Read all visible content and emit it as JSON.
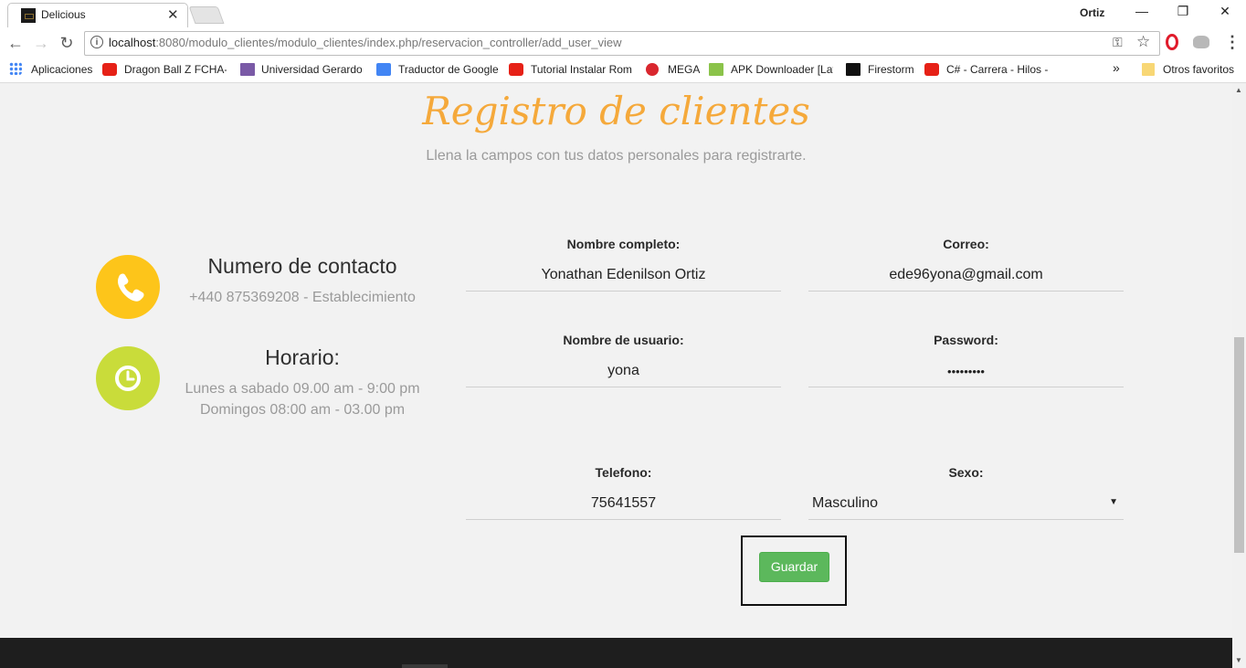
{
  "browser": {
    "tab_title": "Delicious",
    "profile": "Ortiz",
    "url_host": "localhost",
    "url_rest": ":8080/modulo_clientes/modulo_clientes/index.php/reservacion_controller/add_user_view",
    "bookmarks": [
      {
        "label": "Aplicaciones",
        "icon": "apps-grid-icon",
        "color": "#4285f4"
      },
      {
        "label": "Dragon Ball Z FCHA-L",
        "icon": "youtube-icon",
        "color": "#e62117"
      },
      {
        "label": "Universidad Gerardo",
        "icon": "university-icon",
        "color": "#7a5aa6"
      },
      {
        "label": "Traductor de Google",
        "icon": "google-translate-icon",
        "color": "#4285f4"
      },
      {
        "label": "Tutorial Instalar Rom",
        "icon": "youtube-icon",
        "color": "#e62117"
      },
      {
        "label": "MEGA",
        "icon": "mega-icon",
        "color": "#d9272e"
      },
      {
        "label": "APK Downloader [Lat",
        "icon": "apk-downloader-icon",
        "color": "#8bc34a"
      },
      {
        "label": "Firestorm",
        "icon": "firestorm-icon",
        "color": "#111111"
      },
      {
        "label": "C# - Carrera - Hilos -",
        "icon": "youtube-icon",
        "color": "#e62117"
      }
    ],
    "overflow_label": "»",
    "other_bookmarks": "Otros favoritos"
  },
  "page": {
    "title": "Registro de clientes",
    "subtitle": "Llena la campos con tus datos personales para registrarte.",
    "contact": {
      "heading": "Numero de contacto",
      "text": "+440 875369208 - Establecimiento",
      "icon": "phone-icon",
      "color": "#fdc51a"
    },
    "hours": {
      "heading": "Horario:",
      "line1": "Lunes a sabado 09.00 am - 9:00 pm",
      "line2": "Domingos 08:00 am - 03.00 pm",
      "icon": "clock-icon",
      "color": "#c9dc3a"
    },
    "form": {
      "nombre_label": "Nombre completo:",
      "nombre_value": "Yonathan Edenilson Ortiz",
      "correo_label": "Correo:",
      "correo_value": "ede96yona@gmail.com",
      "usuario_label": "Nombre de usuario:",
      "usuario_value": "yona",
      "password_label": "Password:",
      "password_value": "yonaortiz",
      "telefono_label": "Telefono:",
      "telefono_value": "75641557",
      "sexo_label": "Sexo:",
      "sexo_value": "Masculino",
      "save_label": "Guardar"
    }
  }
}
